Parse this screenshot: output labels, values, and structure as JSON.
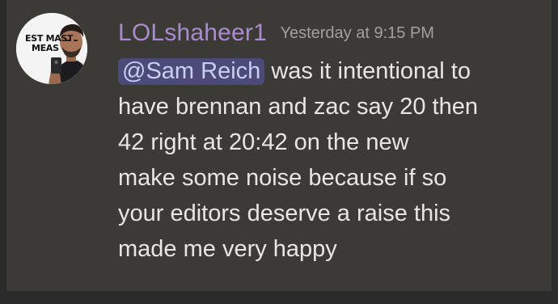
{
  "message": {
    "avatar": {
      "caption_line1": "EST MAST",
      "caption_line2": "MEAS"
    },
    "author": "LOLshaheer1",
    "timestamp": "Yesterday at 9:15 PM",
    "mention": "@Sam Reich",
    "text_lines": [
      " was it intentional to",
      "have brennan and zac say 20 then",
      "42 right at 20:42 on the new",
      "make some noise because if so",
      "your editors deserve a raise this",
      "made me very happy"
    ]
  },
  "colors": {
    "background": "#3c3a35",
    "username": "#a98ccf",
    "timestamp": "#a0a0a0",
    "text": "#e8e6e3",
    "mention_bg": "#4c4b78",
    "mention_text": "#c9cdf6"
  }
}
